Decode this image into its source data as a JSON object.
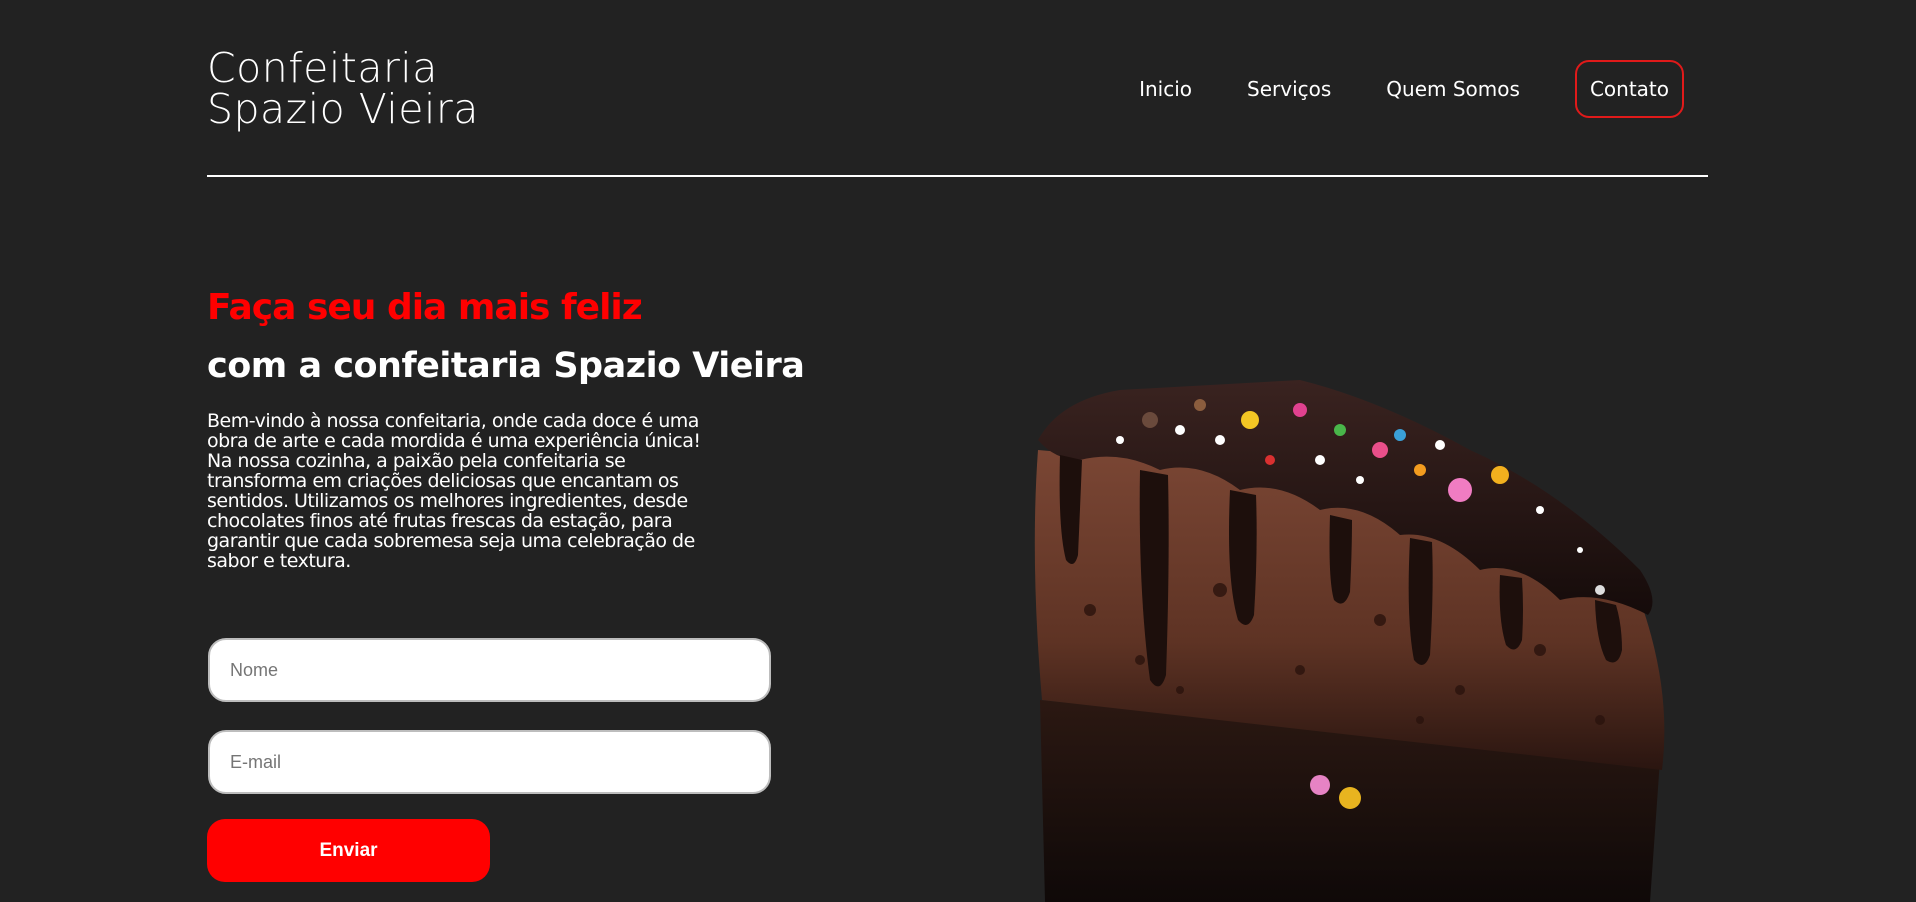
{
  "header": {
    "brand_line1": "Confeitaria",
    "brand_line2": "Spazio Vieira",
    "nav": [
      {
        "label": "Inicio"
      },
      {
        "label": "Serviços"
      },
      {
        "label": "Quem Somos"
      },
      {
        "label": "Contato"
      }
    ]
  },
  "hero": {
    "headline": "Faça seu dia mais feliz",
    "subheadline": "com a confeitaria Spazio Vieira",
    "intro": "Bem-vindo à nossa confeitaria, onde cada doce é uma obra de arte e cada mordida é uma experiência única! Na nossa cozinha, a paixão pela confeitaria se transforma em criações deliciosas que encantam os sentidos. Utilizamos os melhores ingredientes, desde chocolates finos até frutas frescas da estação, para garantir que cada sobremesa seja uma celebração de sabor e textura."
  },
  "form": {
    "name_placeholder": "Nome",
    "email_placeholder": "E-mail",
    "submit_label": "Enviar"
  },
  "colors": {
    "background": "#222222",
    "accent": "#ff0000",
    "contact_border": "#e01a1a",
    "text": "#ffffff"
  }
}
